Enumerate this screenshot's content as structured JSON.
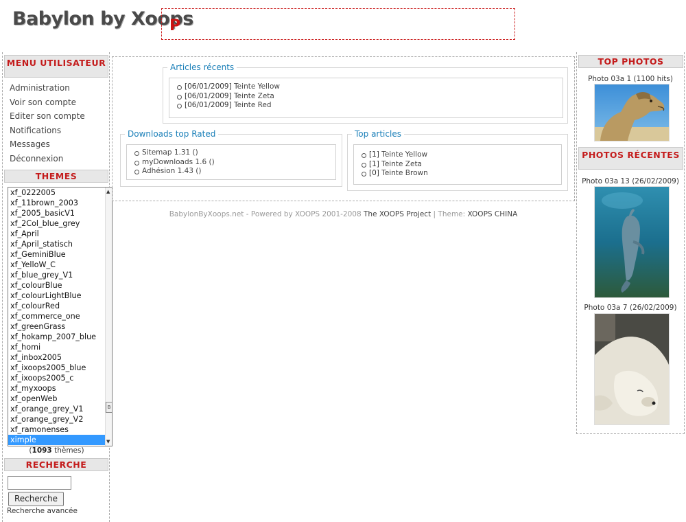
{
  "header": {
    "site_title": "Babylon by Xoops",
    "banner_letter": "P"
  },
  "left": {
    "menu_title": "Menu Utilisateur",
    "menu_items": [
      "Administration",
      "Voir son compte",
      "Editer son compte",
      "Notifications",
      "Messages",
      "Déconnexion"
    ],
    "themes_title": "Themes",
    "themes": [
      "xf_0222005",
      "xf_11brown_2003",
      "xf_2005_basicV1",
      "xf_2Col_blue_grey",
      "xf_April",
      "xf_April_statisch",
      "xf_GeminiBlue",
      "xf_YelloW_C",
      "xf_blue_grey_V1",
      "xf_colourBlue",
      "xf_colourLightBlue",
      "xf_colourRed",
      "xf_commerce_one",
      "xf_greenGrass",
      "xf_hokamp_2007_blue",
      "xf_homi",
      "xf_inbox2005",
      "xf_ixoops2005_blue",
      "xf_ixoops2005_c",
      "xf_myxoops",
      "xf_openWeb",
      "xf_orange_grey_V1",
      "xf_orange_grey_V2",
      "xf_ramonenses",
      "ximple"
    ],
    "selected_theme": "ximple",
    "themes_count_number": "1093",
    "themes_count_suffix": " thèmes)",
    "themes_count_prefix": "(",
    "scrollbar_thumb_glyph": "B",
    "search_title": "Recherche",
    "search_button": "Recherche",
    "advanced_search": "Recherche avancée"
  },
  "center": {
    "recent_articles_title": "Articles récents",
    "recent_articles": [
      {
        "date": "[06/01/2009]",
        "title": " Teinte Yellow"
      },
      {
        "date": "[06/01/2009]",
        "title": " Teinte Zeta"
      },
      {
        "date": "[06/01/2009]",
        "title": " Teinte Red"
      }
    ],
    "downloads_title": "Downloads top Rated",
    "downloads": [
      "Sitemap 1.31 ()",
      "myDownloads 1.6 ()",
      "Adhésion 1.43 ()"
    ],
    "top_articles_title": "Top articles",
    "top_articles": [
      {
        "count": "[1]",
        "title": " Teinte Yellow"
      },
      {
        "count": "[1]",
        "title": " Teinte Zeta"
      },
      {
        "count": "[0]",
        "title": " Teinte Brown"
      }
    ]
  },
  "footer": {
    "text_1": "BabylonByXoops.net - Powered by XOOPS 2001-2008 ",
    "link_1": "The XOOPS Project",
    "text_2": " | Theme: ",
    "link_2": "XOOPS CHINA"
  },
  "right": {
    "top_photos_title": "Top Photos",
    "top_photo_caption": "Photo 03a 1",
    "top_photo_hits": "(1100 hits)",
    "recent_title": "Photos récentes",
    "recent_photos": [
      {
        "caption": "Photo 03a 13",
        "date": "(26/02/2009)"
      },
      {
        "caption": "Photo 03a 7",
        "date": "(26/02/2009)"
      }
    ]
  },
  "colors": {
    "block_title_red": "#c41c1c",
    "legend_blue": "#1a7fb8",
    "selected_blue": "#3399ff"
  }
}
